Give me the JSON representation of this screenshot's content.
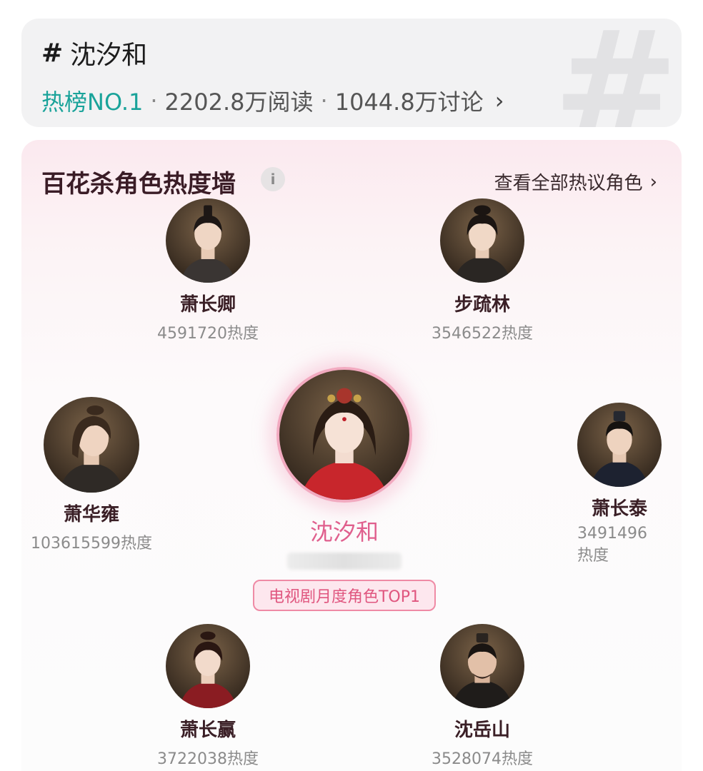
{
  "topic": {
    "hash": "#",
    "title": "沈汐和",
    "rank": "热榜NO.1",
    "sep1": "·",
    "reads": "2202.8万阅读",
    "sep2": "·",
    "discussions": "1044.8万讨论",
    "chevron": "›",
    "bg_hash": "#"
  },
  "wall": {
    "title": "百花杀角色热度墙",
    "info_icon": "i",
    "view_all": "查看全部热议角色",
    "view_all_chevron": "›",
    "center": {
      "name": "沈汐和",
      "badge": "电视剧月度角色TOP1"
    },
    "roles": [
      {
        "name": "萧长卿",
        "heat": "4591720热度"
      },
      {
        "name": "步疏林",
        "heat": "3546522热度"
      },
      {
        "name": "萧华雍",
        "heat": "103615599热度"
      },
      {
        "name": "萧长泰",
        "heat": "3491496热度"
      },
      {
        "name": "萧长赢",
        "heat": "3722038热度"
      },
      {
        "name": "沈岳山",
        "heat": "3528074热度"
      }
    ]
  },
  "colors": {
    "accent_teal": "#1aa39a",
    "accent_pink": "#e0608e",
    "badge_border": "#ef8aa5"
  }
}
